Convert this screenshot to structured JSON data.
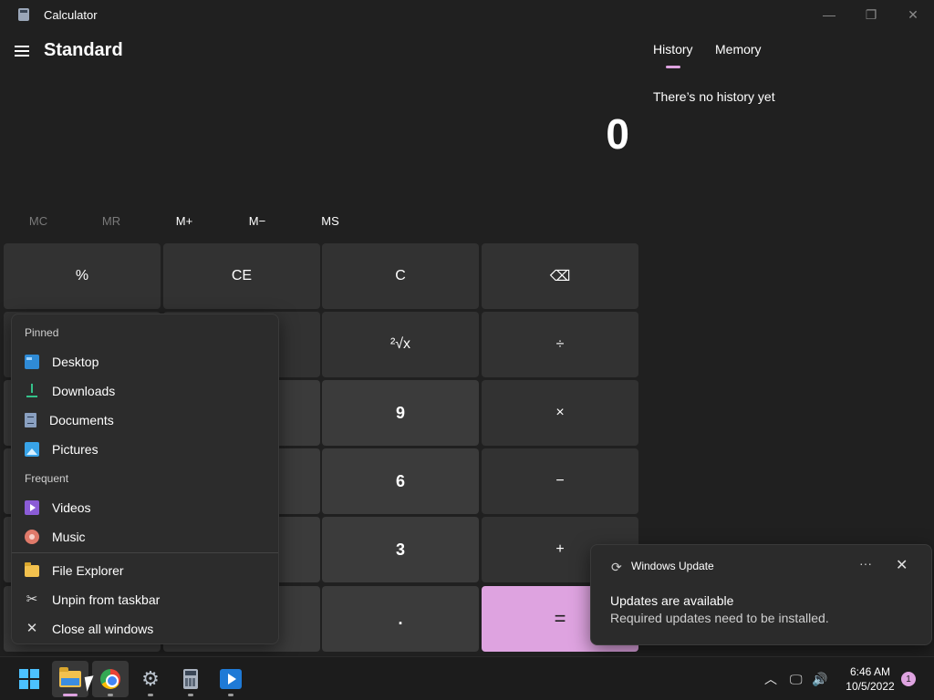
{
  "window": {
    "title": "Calculator",
    "minimize_glyph": "—",
    "maximize_glyph": "❐",
    "close_glyph": "✕"
  },
  "header": {
    "mode": "Standard"
  },
  "display": {
    "value": "0"
  },
  "memory_row": [
    "MC",
    "MR",
    "M+",
    "M−",
    "MS"
  ],
  "keypad": {
    "percent": "%",
    "clear_entry": "CE",
    "clear": "C",
    "backspace": "⌫",
    "root": "²√x",
    "divide": "÷",
    "nine": "9",
    "multiply": "×",
    "six": "6",
    "minus": "−",
    "three": "3",
    "plus": "+",
    "decimal": ".",
    "equals": "="
  },
  "history_panel": {
    "tabs": [
      "History",
      "Memory"
    ],
    "empty_text": "There’s no history yet"
  },
  "jumplist": {
    "pinned_label": "Pinned",
    "pinned": [
      "Desktop",
      "Downloads",
      "Documents",
      "Pictures"
    ],
    "frequent_label": "Frequent",
    "frequent": [
      "Videos",
      "Music"
    ],
    "actions": [
      "File Explorer",
      "Unpin from taskbar",
      "Close all windows"
    ],
    "icons": [
      "folder-desktop-icon",
      "downloads-icon",
      "documents-icon",
      "pictures-icon",
      "videos-icon",
      "music-icon",
      "file-explorer-icon",
      "unpin-icon",
      "close-icon"
    ]
  },
  "toast": {
    "app_name": "Windows Update",
    "title": "Updates are available",
    "body": "Required updates need to be installed.",
    "more_glyph": "···",
    "close_glyph": "✕"
  },
  "taskbar": {
    "apps": [
      "start-icon",
      "file-explorer-icon",
      "chrome-icon",
      "settings-icon",
      "calculator-icon",
      "media-player-icon"
    ],
    "tray": {
      "chevron": "︿",
      "network": "🖵",
      "volume": "🔊"
    },
    "time": "6:46 AM",
    "date": "10/5/2022",
    "notification_count": "1"
  },
  "colors": {
    "background": "#202020",
    "accent": "#dea3e0",
    "key": "#3b3b3b",
    "taskbar": "#1c1c1c"
  }
}
